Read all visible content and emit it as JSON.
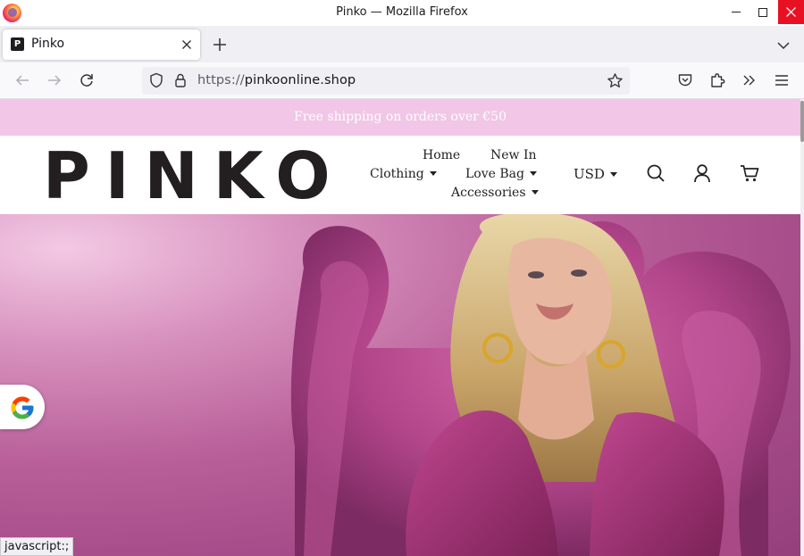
{
  "window": {
    "title": "Pinko — Mozilla Firefox"
  },
  "tabs": [
    {
      "label": "Pinko",
      "favicon_letter": "P",
      "active": true
    }
  ],
  "toolbar": {
    "url_protocol": "https://",
    "url_host": "pinkoonline.shop"
  },
  "site": {
    "promo_text": "Free shipping on orders over €50",
    "logo_text": "PINKO",
    "nav": {
      "home": "Home",
      "new_in": "New In",
      "clothing": "Clothing",
      "love_bag": "Love Bag",
      "accessories": "Accessories"
    },
    "currency": "USD",
    "colors": {
      "promo_bg": "#f1c6e6",
      "hero_magenta": "#a44a88"
    }
  },
  "statusbar": {
    "text": "javascript:;"
  },
  "icons": [
    "firefox-logo-icon",
    "close-icon",
    "plus-icon",
    "chevron-down-icon",
    "back-arrow-icon",
    "forward-arrow-icon",
    "reload-icon",
    "shield-icon",
    "lock-icon",
    "star-icon",
    "pocket-icon",
    "extensions-icon",
    "overflow-icon",
    "hamburger-menu-icon",
    "search-icon",
    "user-icon",
    "cart-icon",
    "google-icon"
  ]
}
